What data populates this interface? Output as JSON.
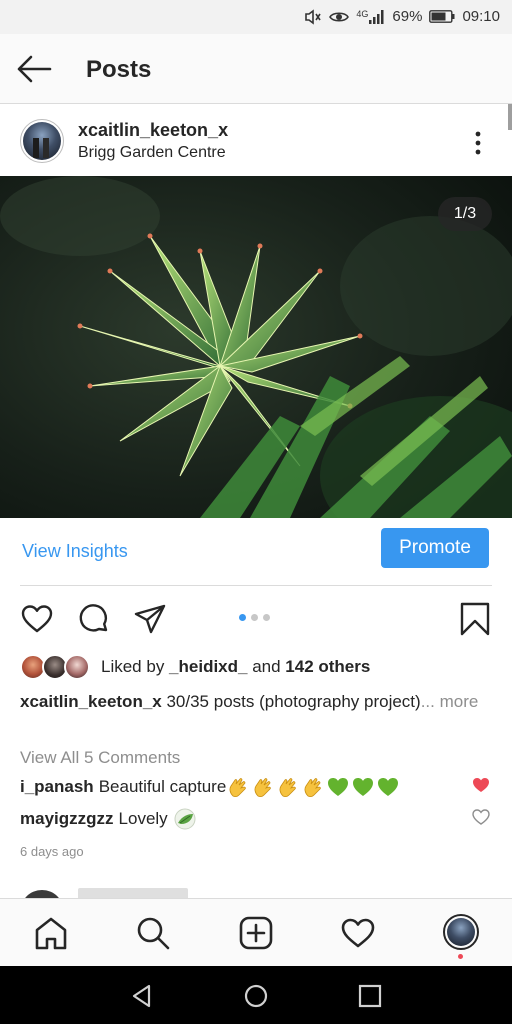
{
  "status_bar": {
    "network": "4G",
    "battery_percent": "69%",
    "time": "09:10",
    "icons": [
      "mute-icon",
      "eye-icon",
      "signal-icon",
      "battery-icon"
    ]
  },
  "header": {
    "title": "Posts",
    "back_icon": "arrow-left-icon"
  },
  "post": {
    "username": "xcaitlin_keeton_x",
    "location": "Brigg Garden Centre",
    "more_icon": "vertical-ellipsis-icon",
    "photo_counter": "1/3",
    "photo_count": 3,
    "active_photo_index": 1,
    "insights": {
      "view_insights_label": "View Insights",
      "promote_label": "Promote"
    },
    "actions": [
      "heart-icon",
      "comment-icon",
      "share-icon",
      "bookmark-icon"
    ],
    "likes": {
      "prefix": "Liked by ",
      "first_user": "_heidixd_",
      "connector": " and ",
      "others": "142 others"
    },
    "caption": {
      "username": "xcaitlin_keeton_x",
      "text": " 30/35 posts (photography project)",
      "more": "... more"
    },
    "view_all_comments": "View All 5 Comments",
    "comments": [
      {
        "username": "i_panash",
        "text": "Beautiful capture",
        "emoji": [
          "👏",
          "👏",
          "👏",
          "👏",
          "💚",
          "💚",
          "💚"
        ],
        "liked": true
      },
      {
        "username": "mayigzzgzz",
        "text": "Lovely",
        "emoji": [
          "🌿"
        ],
        "liked": false
      }
    ],
    "time_ago": "6 days ago"
  },
  "bottom_nav": [
    "home-icon",
    "search-icon",
    "add-post-icon",
    "activity-heart-icon",
    "profile-avatar"
  ],
  "colors": {
    "accent_blue": "#3897f0",
    "like_red": "#ed4956",
    "text_primary": "#262626",
    "text_secondary": "#8e8e8e"
  }
}
